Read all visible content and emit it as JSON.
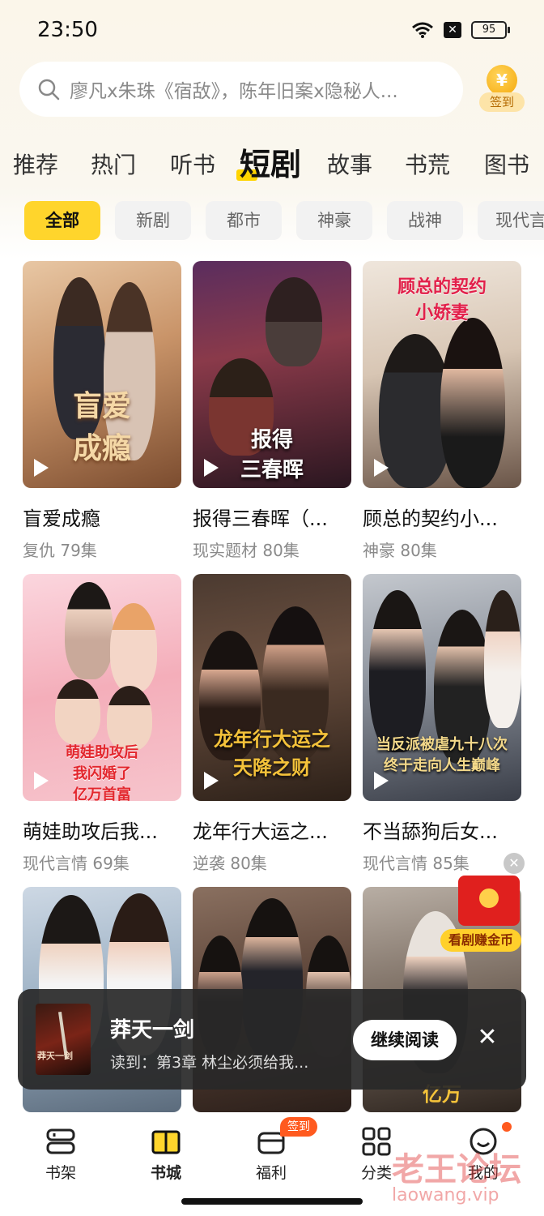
{
  "status": {
    "time": "23:50",
    "battery": "95"
  },
  "search": {
    "placeholder": "廖凡x朱珠《宿敌》，陈年旧案x隐秘人..."
  },
  "signin": {
    "coin": "¥",
    "label": "签到"
  },
  "top_tabs": [
    "推荐",
    "热门",
    "听书",
    "短剧",
    "故事",
    "书荒",
    "图书"
  ],
  "active_top_tab": "短剧",
  "sub_tabs": [
    "全部",
    "新剧",
    "都市",
    "神豪",
    "战神",
    "现代言"
  ],
  "cards": [
    {
      "title": "盲爱成瘾",
      "genre": "复仇",
      "episodes": "79集",
      "poster_text": "盲爱\n成瘾"
    },
    {
      "title": "报得三春晖（...",
      "genre": "现实题材",
      "episodes": "80集",
      "poster_text": "报得\n三春晖"
    },
    {
      "title": "顾总的契约小...",
      "genre": "神豪",
      "episodes": "80集",
      "poster_text": "顾总的契约\n小娇妻"
    },
    {
      "title": "萌娃助攻后我...",
      "genre": "现代言情",
      "episodes": "69集",
      "poster_text": "萌娃助攻后\n我闪婚了\n亿万首富"
    },
    {
      "title": "龙年行大运之...",
      "genre": "逆袭",
      "episodes": "80集",
      "poster_text": "龙年行大运之\n天降之财"
    },
    {
      "title": "不当舔狗后女...",
      "genre": "现代言情",
      "episodes": "85集",
      "poster_text": "当反派被虐九十八次\n终于走向人生巅峰"
    },
    {
      "title": "",
      "genre": "",
      "episodes": "",
      "poster_text": ""
    },
    {
      "title": "",
      "genre": "",
      "episodes": "",
      "poster_text": ""
    },
    {
      "title": "",
      "genre": "",
      "episodes": "",
      "poster_text": "亿万"
    }
  ],
  "float_reward": {
    "label": "看剧赚金币"
  },
  "mini_player": {
    "title": "莽天一剑",
    "progress": "读到：第3章  林尘必须给我...",
    "continue_label": "继续阅读",
    "cover_text": "莽天一剑"
  },
  "bottom_nav": [
    {
      "label": "书架",
      "icon": "bookshelf-icon"
    },
    {
      "label": "书城",
      "icon": "bookstore-icon",
      "active": true
    },
    {
      "label": "福利",
      "icon": "gift-box-icon",
      "badge": "签到"
    },
    {
      "label": "分类",
      "icon": "grid-icon"
    },
    {
      "label": "我的",
      "icon": "profile-icon",
      "dot": true
    }
  ],
  "watermark": {
    "cn": "老王论坛",
    "en": "laowang.vip"
  },
  "colors": {
    "accent": "#ffd52c",
    "badge": "#ff5a1f",
    "envelope": "#e0201e"
  }
}
